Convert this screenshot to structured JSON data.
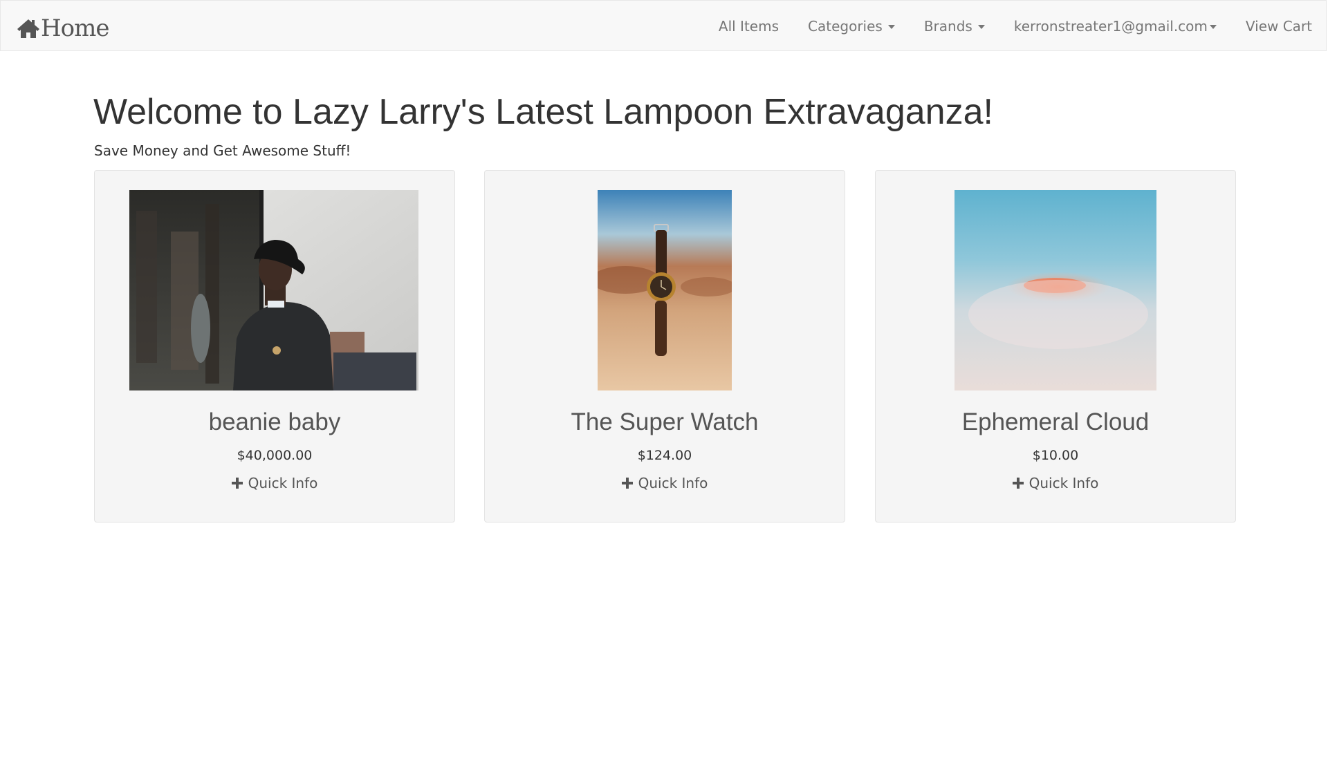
{
  "navbar": {
    "brand": {
      "icon": "home-icon",
      "label": "Home"
    },
    "items": [
      {
        "label": "All Items",
        "dropdown": false
      },
      {
        "label": "Categories",
        "dropdown": true
      },
      {
        "label": "Brands",
        "dropdown": true
      },
      {
        "label": "kerronstreater1@gmail.com",
        "dropdown": true
      },
      {
        "label": "View Cart",
        "dropdown": false
      }
    ]
  },
  "main": {
    "title": "Welcome to Lazy Larry's Latest Lampoon Extravaganza!",
    "subtitle": "Save Money and Get Awesome Stuff!"
  },
  "products": [
    {
      "name": "beanie baby",
      "price": "$40,000.00",
      "quick_info": "Quick Info",
      "image": "man-in-hat-photo"
    },
    {
      "name": "The Super Watch",
      "price": "$124.00",
      "quick_info": "Quick Info",
      "image": "wristwatch-photo"
    },
    {
      "name": "Ephemeral Cloud",
      "price": "$10.00",
      "quick_info": "Quick Info",
      "image": "pink-cloud-photo"
    }
  ],
  "colors": {
    "navbar_bg": "#f8f8f8",
    "nav_text": "#777777",
    "card_bg": "#f5f5f5",
    "text": "#333333"
  }
}
